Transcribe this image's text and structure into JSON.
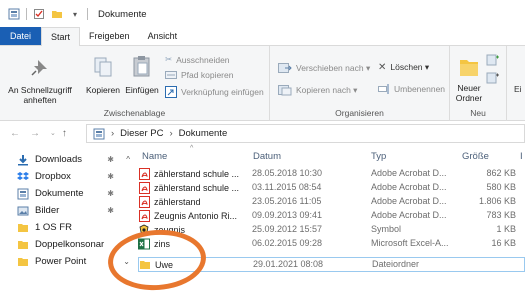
{
  "window": {
    "title": "Dokumente"
  },
  "tabs": [
    {
      "label": "Datei"
    },
    {
      "label": "Start"
    },
    {
      "label": "Freigeben"
    },
    {
      "label": "Ansicht"
    }
  ],
  "ribbon": {
    "clipboard": {
      "pin_label_1": "An Schnellzugriff",
      "pin_label_2": "anheften",
      "copy_label": "Kopieren",
      "paste_label": "Einfügen",
      "cut_label": "Ausschneiden",
      "copy_path_label": "Pfad kopieren",
      "paste_shortcut_label": "Verknüpfung einfügen",
      "group_label": "Zwischenablage"
    },
    "organize": {
      "move_to_label": "Verschieben nach ▾",
      "copy_to_label": "Kopieren nach ▾",
      "delete_label": "Löschen ▾",
      "rename_label": "Umbenennen",
      "group_label": "Organisieren"
    },
    "new": {
      "new_folder_label_1": "Neuer",
      "new_folder_label_2": "Ordner",
      "group_label": "Neu",
      "cut_off_label": "Ei"
    }
  },
  "address": {
    "crumbs": [
      "Dieser PC",
      "Dokumente"
    ]
  },
  "nav_pane": {
    "items": [
      {
        "label": "Downloads",
        "pinned": true
      },
      {
        "label": "Dropbox",
        "pinned": true
      },
      {
        "label": "Dokumente",
        "pinned": true
      },
      {
        "label": "Bilder",
        "pinned": true
      },
      {
        "label": "1 OS FR",
        "pinned": false
      },
      {
        "label": "Doppelkonsonar",
        "pinned": false
      },
      {
        "label": "Power Point",
        "pinned": false
      }
    ]
  },
  "file_list": {
    "columns": {
      "name": "Name",
      "date": "Datum",
      "type": "Typ",
      "size": "Größe",
      "more": "I"
    },
    "rows": [
      {
        "name": "zählerstand schule ...",
        "date": "28.05.2018 10:30",
        "type": "Adobe Acrobat D...",
        "size": "862 KB",
        "icon": "pdf-icon"
      },
      {
        "name": "zählerstand schule ...",
        "date": "03.11.2015 08:54",
        "type": "Adobe Acrobat D...",
        "size": "580 KB",
        "icon": "pdf-icon"
      },
      {
        "name": "zählerstand",
        "date": "23.05.2016 11:05",
        "type": "Adobe Acrobat D...",
        "size": "1.806 KB",
        "icon": "pdf-icon"
      },
      {
        "name": "Zeugnis Antonio Ri...",
        "date": "09.09.2013 09:41",
        "type": "Adobe Acrobat D...",
        "size": "783 KB",
        "icon": "pdf-icon"
      },
      {
        "name": "zeugnis",
        "date": "25.09.2012 15:57",
        "type": "Symbol",
        "size": "1 KB",
        "icon": "symbol-icon"
      },
      {
        "name": "zins",
        "date": "06.02.2015 09:28",
        "type": "Microsoft Excel-A...",
        "size": "16 KB",
        "icon": "excel-icon"
      },
      {
        "name": "Uwe",
        "date": "29.01.2021 08:08",
        "type": "Dateiordner",
        "size": "",
        "icon": "folder-icon"
      }
    ]
  },
  "colors": {
    "accent": "#1a5fb4",
    "highlight_circle": "#e8772e",
    "folder": "#f4c542",
    "pdf": "#d93025",
    "excel": "#1e7145"
  }
}
